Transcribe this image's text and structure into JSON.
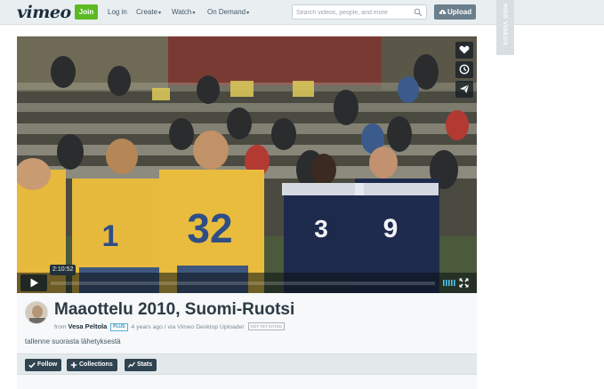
{
  "header": {
    "logo": "vimeo",
    "join_label": "Join",
    "nav": {
      "login": "Log in",
      "create": "Create",
      "watch": "Watch",
      "on_demand": "On Demand"
    },
    "search_placeholder": "Search videos, people, and more",
    "upload_label": "Upload"
  },
  "hide_videos_label": "HIDE VIDEOS",
  "player": {
    "time": "2:10:52",
    "jersey_numbers": [
      "1",
      "32",
      "3",
      "9"
    ]
  },
  "video_info": {
    "title": "Maaottelu 2010, Suomi-Ruotsi",
    "from_label": "from",
    "author": "Vesa Peltola",
    "badge": "PLUS",
    "meta": "4 years ago / via Vimeo Desktop Uploader",
    "rating": "NOT YET RATED",
    "description": "tallenne suorasta lähetyksestä"
  },
  "actions": {
    "follow": "Follow",
    "collections": "Collections",
    "stats": "Stats"
  },
  "colors": {
    "brand_dark": "#1a2e3b",
    "join_green": "#5bb923",
    "upload_gray": "#6c7f8c",
    "action_button": "#2f4350"
  }
}
